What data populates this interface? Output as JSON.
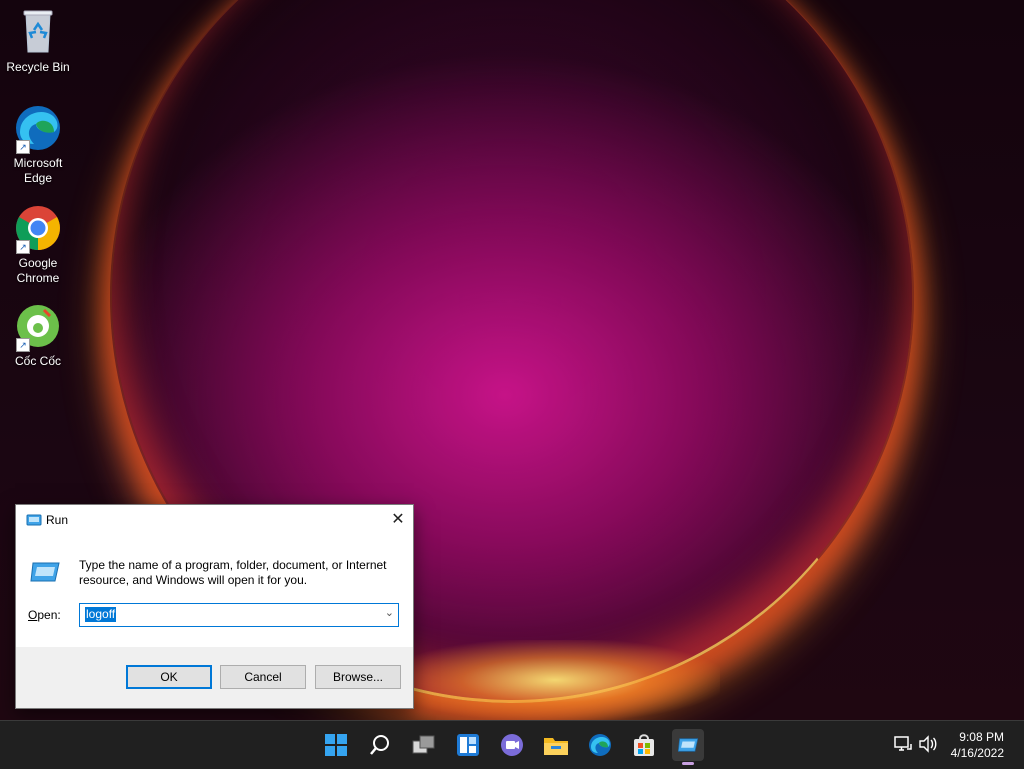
{
  "desktop": {
    "icons": [
      {
        "label": "Recycle Bin",
        "icon": "recycle-bin-icon"
      },
      {
        "label": "Microsoft\nEdge",
        "icon": "edge-icon"
      },
      {
        "label": "Google\nChrome",
        "icon": "chrome-icon"
      },
      {
        "label": "Cốc Cốc",
        "icon": "coccoc-icon"
      }
    ]
  },
  "run_dialog": {
    "title": "Run",
    "description": "Type the name of a program, folder, document, or Internet resource, and Windows will open it for you.",
    "open_label": "Open:",
    "open_value": "logoff",
    "buttons": {
      "ok": "OK",
      "cancel": "Cancel",
      "browse": "Browse..."
    }
  },
  "taskbar": {
    "apps": [
      "start-icon",
      "search-icon",
      "task-view-icon",
      "widgets-icon",
      "chat-icon",
      "file-explorer-icon",
      "edge-icon",
      "store-icon",
      "run-icon"
    ],
    "clock": {
      "time": "9:08 PM",
      "date": "4/16/2022"
    }
  },
  "colors": {
    "accent": "#0078d7",
    "taskbar": "#202020"
  }
}
